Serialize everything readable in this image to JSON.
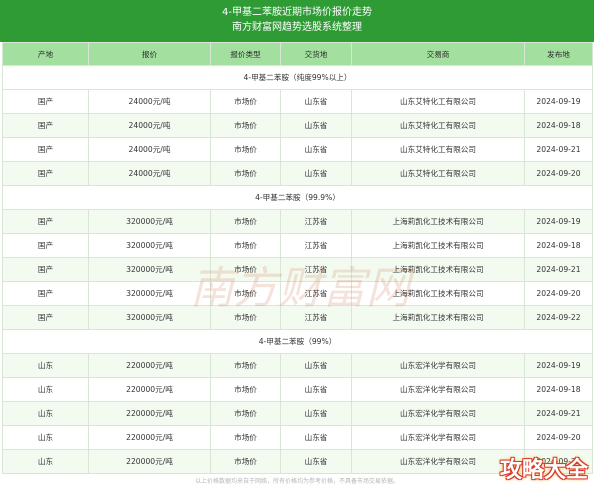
{
  "header": {
    "title_line1": "4-甲基二苯胺近期市场价报价走势",
    "title_line2": "南方财富网趋势选股系统整理"
  },
  "table": {
    "columns": [
      "产地",
      "报价",
      "报价类型",
      "交货地",
      "交易商",
      "发布地"
    ],
    "groups": [
      {
        "title": "4-甲基二苯胺（纯度99%以上）",
        "rows": [
          [
            "国产",
            "24000元/吨",
            "市场价",
            "山东省",
            "山东艾特化工有限公司",
            "2024-09-19"
          ],
          [
            "国产",
            "24000元/吨",
            "市场价",
            "山东省",
            "山东艾特化工有限公司",
            "2024-09-18"
          ],
          [
            "国产",
            "24000元/吨",
            "市场价",
            "山东省",
            "山东艾特化工有限公司",
            "2024-09-21"
          ],
          [
            "国产",
            "24000元/吨",
            "市场价",
            "山东省",
            "山东艾特化工有限公司",
            "2024-09-20"
          ]
        ]
      },
      {
        "title": "4-甲基二苯胺（99.9%）",
        "rows": [
          [
            "国产",
            "320000元/吨",
            "市场价",
            "江苏省",
            "上海莉凯化工技术有限公司",
            "2024-09-19"
          ],
          [
            "国产",
            "320000元/吨",
            "市场价",
            "江苏省",
            "上海莉凯化工技术有限公司",
            "2024-09-18"
          ],
          [
            "国产",
            "320000元/吨",
            "市场价",
            "江苏省",
            "上海莉凯化工技术有限公司",
            "2024-09-21"
          ],
          [
            "国产",
            "320000元/吨",
            "市场价",
            "江苏省",
            "上海莉凯化工技术有限公司",
            "2024-09-20"
          ],
          [
            "国产",
            "320000元/吨",
            "市场价",
            "江苏省",
            "上海莉凯化工技术有限公司",
            "2024-09-22"
          ]
        ]
      },
      {
        "title": "4-甲基二苯胺（99%）",
        "rows": [
          [
            "山东",
            "220000元/吨",
            "市场价",
            "山东省",
            "山东宏洋化学有限公司",
            "2024-09-19"
          ],
          [
            "山东",
            "220000元/吨",
            "市场价",
            "山东省",
            "山东宏洋化学有限公司",
            "2024-09-18"
          ],
          [
            "山东",
            "220000元/吨",
            "市场价",
            "山东省",
            "山东宏洋化学有限公司",
            "2024-09-21"
          ],
          [
            "山东",
            "220000元/吨",
            "市场价",
            "山东省",
            "山东宏洋化学有限公司",
            "2024-09-20"
          ],
          [
            "山东",
            "220000元/吨",
            "市场价",
            "山东省",
            "山东宏洋化学有限公司",
            "2024-09-22"
          ]
        ]
      }
    ]
  },
  "footer": "以上价格数据均来自于网络，所有价格均为参考价格，不具备市场交易依据。",
  "watermark": "南方财富网",
  "corner_logo": "攻略大全",
  "colors": {
    "header_bg": "#2e9b35",
    "column_header_bg": "#a3e0a0",
    "row_alt_bg": "#f3fbf1",
    "border": "#d8e6d6"
  }
}
